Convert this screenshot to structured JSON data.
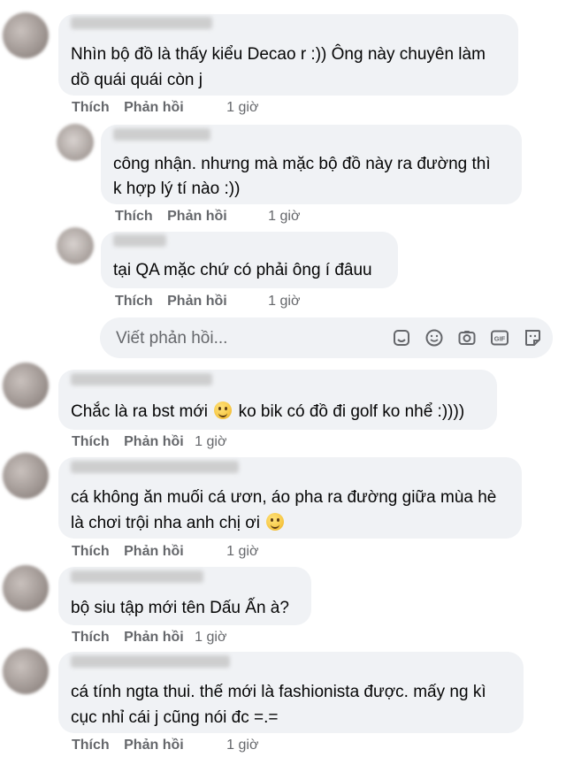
{
  "actions": {
    "like": "Thích",
    "reply": "Phản hồi"
  },
  "comments": [
    {
      "text_lines": [
        "Nhìn bộ đồ là thấy kiểu Decao r :)) Ông này chuyên làm",
        "dồ quái quái còn j"
      ],
      "time": "1 giờ"
    },
    {
      "text_lines": [
        "công nhận. nhưng mà mặc bộ đồ này ra đường thì",
        "k hợp lý tí nào :))"
      ],
      "time": "1 giờ"
    },
    {
      "text_lines": [
        "tại QA mặc chứ có phải ông í đâuu"
      ],
      "time": "1 giờ"
    },
    {
      "text_before_emoji": "Chắc là ra bst mới",
      "text_after_emoji": "ko bik có đồ đi golf ko nhể :))))",
      "time": "1 giờ"
    },
    {
      "text_lines": [
        "cá không ăn muối cá ươn, áo pha ra đường giữa mùa hè",
        "là chơi trội nha anh chị ơi"
      ],
      "time": "1 giờ"
    },
    {
      "text_lines": [
        "bộ siu tập mới tên Dấu Ấn à?"
      ],
      "time": "1 giờ"
    },
    {
      "text_lines": [
        "cá tính ngta thui. thế mới là fashionista được. mấy ng kì",
        "cục nhỉ cái j cũng nói đc =.="
      ],
      "time": "1 giờ"
    }
  ],
  "reply_box": {
    "placeholder": "Viết phản hồi...",
    "icons": [
      "sticker-icon",
      "emoji-icon",
      "camera-icon",
      "gif-icon",
      "avatar-sticker-icon"
    ]
  },
  "colors": {
    "bubble": "#f0f2f5",
    "meta": "#65676b",
    "text": "#050505"
  }
}
